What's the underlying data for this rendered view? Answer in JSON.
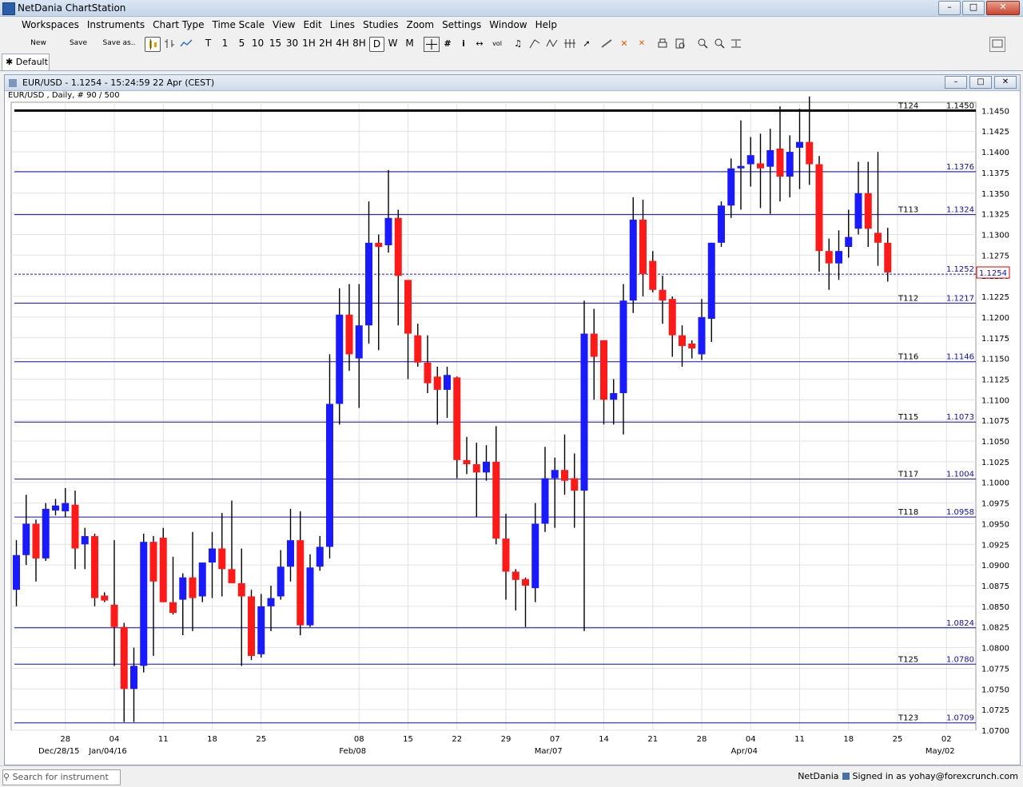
{
  "window": {
    "title": "NetDania ChartStation",
    "min_label": "–",
    "max_label": "□",
    "close_label": "✕"
  },
  "menu": [
    "Workspaces",
    "Instruments",
    "Chart Type",
    "Time Scale",
    "View",
    "Edit",
    "Lines",
    "Studies",
    "Zoom",
    "Settings",
    "Window",
    "Help"
  ],
  "toolbar": {
    "new_label": "New",
    "save_label": "Save",
    "saveas_label": "Save as..",
    "timescales": [
      "T",
      "1",
      "5",
      "10",
      "15",
      "30",
      "1H",
      "2H",
      "4H",
      "8H",
      "D",
      "W",
      "M"
    ],
    "selected_timescale": "D",
    "icons": [
      "candle-icon",
      "bar-chart-icon",
      "line-chart-icon",
      "crosshair-icon",
      "grid-icon",
      "info-icon",
      "arrows-icon",
      "volume-icon",
      "bell-icon",
      "trend-icon",
      "zigzag-icon",
      "fork-icon",
      "cursor-icon",
      "pen-icon",
      "delete-icon",
      "delete-all-icon",
      "print-icon",
      "print-preview-icon",
      "zoom-in-icon",
      "zoom-out-icon",
      "fit-icon",
      "panel-icon"
    ]
  },
  "tabs": [
    {
      "label": "Default"
    }
  ],
  "chart_window": {
    "title": "EUR/USD - 1.1254 - 15:24:59  22 Apr (CEST)",
    "subtitle": "EUR/USD , Daily, # 90 / 500"
  },
  "status": {
    "search_placeholder": "Search for instrument",
    "provider": "NetDania",
    "signed_in": "Signed in as yohay@forexcrunch.com"
  },
  "chart_data": {
    "type": "candlestick",
    "title": "EUR/USD , Daily, # 90 / 500",
    "ylim": [
      1.07,
      1.146
    ],
    "y_ticks": [
      "1.1450",
      "1.1425",
      "1.1400",
      "1.1375",
      "1.1350",
      "1.1325",
      "1.1300",
      "1.1275",
      "1.1250",
      "1.1225",
      "1.1200",
      "1.1175",
      "1.1150",
      "1.1125",
      "1.1100",
      "1.1075",
      "1.1050",
      "1.1025",
      "1.1000",
      "1.0975",
      "1.0950",
      "1.0925",
      "1.0900",
      "1.0875",
      "1.0850",
      "1.0825",
      "1.0800",
      "1.0775",
      "1.0750",
      "1.0725",
      "1.0700"
    ],
    "x_ticks": [
      {
        "day": "28",
        "month": "Dec/28/15",
        "idx": 5
      },
      {
        "day": "04",
        "month": "Jan/04/16",
        "idx": 10
      },
      {
        "day": "11",
        "month": "",
        "idx": 15
      },
      {
        "day": "18",
        "month": "",
        "idx": 20
      },
      {
        "day": "25",
        "month": "",
        "idx": 25
      },
      {
        "day": "08",
        "month": "Feb/08",
        "idx": 35
      },
      {
        "day": "15",
        "month": "",
        "idx": 40
      },
      {
        "day": "22",
        "month": "",
        "idx": 45
      },
      {
        "day": "29",
        "month": "",
        "idx": 50
      },
      {
        "day": "07",
        "month": "Mar/07",
        "idx": 55
      },
      {
        "day": "14",
        "month": "",
        "idx": 60
      },
      {
        "day": "21",
        "month": "",
        "idx": 65
      },
      {
        "day": "28",
        "month": "",
        "idx": 70
      },
      {
        "day": "04",
        "month": "Apr/04",
        "idx": 75
      },
      {
        "day": "11",
        "month": "",
        "idx": 80
      },
      {
        "day": "18",
        "month": "",
        "idx": 85
      },
      {
        "day": "25",
        "month": "",
        "idx": 90
      },
      {
        "day": "02",
        "month": "May/02",
        "idx": 95
      }
    ],
    "hlines": [
      {
        "label": "T124",
        "value": "1.1450",
        "y": 1.145,
        "bold": true
      },
      {
        "label": "",
        "value": "1.1376",
        "y": 1.1376
      },
      {
        "label": "T113",
        "value": "1.1324",
        "y": 1.1324
      },
      {
        "label": "",
        "value": "1.1252",
        "y": 1.1252,
        "dashed": true
      },
      {
        "label": "T112",
        "value": "1.1217",
        "y": 1.1217
      },
      {
        "label": "T116",
        "value": "1.1146",
        "y": 1.1146
      },
      {
        "label": "T115",
        "value": "1.1073",
        "y": 1.1073
      },
      {
        "label": "T117",
        "value": "1.1004",
        "y": 1.1004
      },
      {
        "label": "T118",
        "value": "1.0958",
        "y": 1.0958
      },
      {
        "label": "",
        "value": "1.0824",
        "y": 1.0824
      },
      {
        "label": "T125",
        "value": "1.0780",
        "y": 1.078
      },
      {
        "label": "T123",
        "value": "1.0709",
        "y": 1.0709
      }
    ],
    "current_price": "1.1254",
    "candles": [
      {
        "o": 1.087,
        "h": 1.093,
        "l": 1.085,
        "c": 1.0912
      },
      {
        "o": 1.0912,
        "h": 1.0985,
        "l": 1.09,
        "c": 1.095
      },
      {
        "o": 1.095,
        "h": 1.0955,
        "l": 1.088,
        "c": 1.0908
      },
      {
        "o": 1.0908,
        "h": 1.0975,
        "l": 1.0905,
        "c": 1.0968
      },
      {
        "o": 1.0966,
        "h": 1.098,
        "l": 1.096,
        "c": 1.0972
      },
      {
        "o": 1.0965,
        "h": 1.0993,
        "l": 1.0958,
        "c": 1.0975
      },
      {
        "o": 1.0973,
        "h": 1.099,
        "l": 1.0895,
        "c": 1.092
      },
      {
        "o": 1.0925,
        "h": 1.0945,
        "l": 1.0895,
        "c": 1.0935
      },
      {
        "o": 1.0935,
        "h": 1.0938,
        "l": 1.085,
        "c": 1.086
      },
      {
        "o": 1.0863,
        "h": 1.0867,
        "l": 1.0855,
        "c": 1.0857
      },
      {
        "o": 1.0852,
        "h": 1.093,
        "l": 1.0778,
        "c": 1.0825
      },
      {
        "o": 1.0825,
        "h": 1.083,
        "l": 1.071,
        "c": 1.075
      },
      {
        "o": 1.075,
        "h": 1.08,
        "l": 1.071,
        "c": 1.0778
      },
      {
        "o": 1.0778,
        "h": 1.0938,
        "l": 1.077,
        "c": 1.0928
      },
      {
        "o": 1.0928,
        "h": 1.0935,
        "l": 1.079,
        "c": 1.088
      },
      {
        "o": 1.0933,
        "h": 1.0945,
        "l": 1.0855,
        "c": 1.0855
      },
      {
        "o": 1.0855,
        "h": 1.091,
        "l": 1.084,
        "c": 1.0842
      },
      {
        "o": 1.0858,
        "h": 1.089,
        "l": 1.0815,
        "c": 1.0885
      },
      {
        "o": 1.0885,
        "h": 1.094,
        "l": 1.082,
        "c": 1.086
      },
      {
        "o": 1.0862,
        "h": 1.0898,
        "l": 1.0855,
        "c": 1.0903
      },
      {
        "o": 1.0903,
        "h": 1.094,
        "l": 1.086,
        "c": 1.092
      },
      {
        "o": 1.092,
        "h": 1.0963,
        "l": 1.0862,
        "c": 1.0895
      },
      {
        "o": 1.0895,
        "h": 1.0978,
        "l": 1.088,
        "c": 1.0878
      },
      {
        "o": 1.0878,
        "h": 1.092,
        "l": 1.0778,
        "c": 1.0862
      },
      {
        "o": 1.0862,
        "h": 1.087,
        "l": 1.0785,
        "c": 1.079
      },
      {
        "o": 1.0792,
        "h": 1.0865,
        "l": 1.0788,
        "c": 1.085
      },
      {
        "o": 1.085,
        "h": 1.0875,
        "l": 1.082,
        "c": 1.086
      },
      {
        "o": 1.0862,
        "h": 1.0918,
        "l": 1.0858,
        "c": 1.0898
      },
      {
        "o": 1.0898,
        "h": 1.0968,
        "l": 1.088,
        "c": 1.093
      },
      {
        "o": 1.093,
        "h": 1.0965,
        "l": 1.0815,
        "c": 1.0827
      },
      {
        "o": 1.0827,
        "h": 1.0913,
        "l": 1.0825,
        "c": 1.0897
      },
      {
        "o": 1.0898,
        "h": 1.0935,
        "l": 1.0893,
        "c": 1.0922
      },
      {
        "o": 1.0922,
        "h": 1.1155,
        "l": 1.0908,
        "c": 1.1095
      },
      {
        "o": 1.1095,
        "h": 1.1235,
        "l": 1.107,
        "c": 1.1203
      },
      {
        "o": 1.1203,
        "h": 1.124,
        "l": 1.1135,
        "c": 1.1155
      },
      {
        "o": 1.115,
        "h": 1.124,
        "l": 1.109,
        "c": 1.119
      },
      {
        "o": 1.119,
        "h": 1.134,
        "l": 1.1168,
        "c": 1.129
      },
      {
        "o": 1.129,
        "h": 1.13,
        "l": 1.116,
        "c": 1.1285
      },
      {
        "o": 1.1287,
        "h": 1.1378,
        "l": 1.1278,
        "c": 1.132
      },
      {
        "o": 1.132,
        "h": 1.133,
        "l": 1.119,
        "c": 1.125
      },
      {
        "o": 1.1245,
        "h": 1.1235,
        "l": 1.1125,
        "c": 1.118
      },
      {
        "o": 1.1178,
        "h": 1.1192,
        "l": 1.114,
        "c": 1.1145
      },
      {
        "o": 1.1145,
        "h": 1.1178,
        "l": 1.1108,
        "c": 1.112
      },
      {
        "o": 1.1128,
        "h": 1.114,
        "l": 1.107,
        "c": 1.1112
      },
      {
        "o": 1.1112,
        "h": 1.114,
        "l": 1.1078,
        "c": 1.113
      },
      {
        "o": 1.1127,
        "h": 1.1128,
        "l": 1.1005,
        "c": 1.1027
      },
      {
        "o": 1.1027,
        "h": 1.1055,
        "l": 1.101,
        "c": 1.1022
      },
      {
        "o": 1.1022,
        "h": 1.1048,
        "l": 1.0958,
        "c": 1.1012
      },
      {
        "o": 1.1012,
        "h": 1.1045,
        "l": 1.1002,
        "c": 1.1025
      },
      {
        "o": 1.1025,
        "h": 1.1068,
        "l": 1.0925,
        "c": 1.0932
      },
      {
        "o": 1.0932,
        "h": 1.0962,
        "l": 1.0858,
        "c": 1.0892
      },
      {
        "o": 1.0892,
        "h": 1.0895,
        "l": 1.0845,
        "c": 1.0882
      },
      {
        "o": 1.0883,
        "h": 1.0885,
        "l": 1.0825,
        "c": 1.0875
      },
      {
        "o": 1.0872,
        "h": 1.0975,
        "l": 1.0855,
        "c": 1.095
      },
      {
        "o": 1.095,
        "h": 1.1043,
        "l": 1.094,
        "c": 1.1005
      },
      {
        "o": 1.1005,
        "h": 1.103,
        "l": 1.0945,
        "c": 1.1015
      },
      {
        "o": 1.1015,
        "h": 1.1058,
        "l": 1.0985,
        "c": 1.1002
      },
      {
        "o": 1.1005,
        "h": 1.1035,
        "l": 1.0945,
        "c": 1.099
      },
      {
        "o": 1.099,
        "h": 1.122,
        "l": 1.082,
        "c": 1.118
      },
      {
        "o": 1.118,
        "h": 1.121,
        "l": 1.11,
        "c": 1.1152
      },
      {
        "o": 1.1172,
        "h": 1.1168,
        "l": 1.107,
        "c": 1.11
      },
      {
        "o": 1.11,
        "h": 1.1125,
        "l": 1.107,
        "c": 1.1108
      },
      {
        "o": 1.1108,
        "h": 1.124,
        "l": 1.1058,
        "c": 1.122
      },
      {
        "o": 1.122,
        "h": 1.1345,
        "l": 1.1205,
        "c": 1.1318
      },
      {
        "o": 1.1318,
        "h": 1.1342,
        "l": 1.1225,
        "c": 1.1252
      },
      {
        "o": 1.1268,
        "h": 1.128,
        "l": 1.123,
        "c": 1.1233
      },
      {
        "o": 1.1233,
        "h": 1.125,
        "l": 1.1192,
        "c": 1.122
      },
      {
        "o": 1.1222,
        "h": 1.1225,
        "l": 1.1152,
        "c": 1.1178
      },
      {
        "o": 1.1178,
        "h": 1.119,
        "l": 1.114,
        "c": 1.1165
      },
      {
        "o": 1.1168,
        "h": 1.1172,
        "l": 1.115,
        "c": 1.1162
      },
      {
        "o": 1.1155,
        "h": 1.1222,
        "l": 1.1148,
        "c": 1.12
      },
      {
        "o": 1.1198,
        "h": 1.129,
        "l": 1.117,
        "c": 1.129
      },
      {
        "o": 1.129,
        "h": 1.134,
        "l": 1.1285,
        "c": 1.1335
      },
      {
        "o": 1.1335,
        "h": 1.1392,
        "l": 1.132,
        "c": 1.138
      },
      {
        "o": 1.138,
        "h": 1.1438,
        "l": 1.133,
        "c": 1.1383
      },
      {
        "o": 1.1385,
        "h": 1.1418,
        "l": 1.1358,
        "c": 1.1396
      },
      {
        "o": 1.1386,
        "h": 1.1422,
        "l": 1.1332,
        "c": 1.138
      },
      {
        "o": 1.1382,
        "h": 1.1428,
        "l": 1.1325,
        "c": 1.1402
      },
      {
        "o": 1.1404,
        "h": 1.1455,
        "l": 1.134,
        "c": 1.137
      },
      {
        "o": 1.137,
        "h": 1.142,
        "l": 1.1345,
        "c": 1.14
      },
      {
        "o": 1.1405,
        "h": 1.1452,
        "l": 1.1355,
        "c": 1.1412
      },
      {
        "o": 1.1412,
        "h": 1.1467,
        "l": 1.136,
        "c": 1.1385
      },
      {
        "o": 1.1385,
        "h": 1.1395,
        "l": 1.1255,
        "c": 1.128
      },
      {
        "o": 1.128,
        "h": 1.1295,
        "l": 1.1233,
        "c": 1.1265
      },
      {
        "o": 1.1265,
        "h": 1.1305,
        "l": 1.1245,
        "c": 1.128
      },
      {
        "o": 1.1285,
        "h": 1.133,
        "l": 1.1272,
        "c": 1.1297
      },
      {
        "o": 1.1307,
        "h": 1.1388,
        "l": 1.13,
        "c": 1.135
      },
      {
        "o": 1.135,
        "h": 1.1388,
        "l": 1.1285,
        "c": 1.1307
      },
      {
        "o": 1.1302,
        "h": 1.14,
        "l": 1.1262,
        "c": 1.129
      },
      {
        "o": 1.129,
        "h": 1.1308,
        "l": 1.1243,
        "c": 1.1254
      }
    ]
  }
}
